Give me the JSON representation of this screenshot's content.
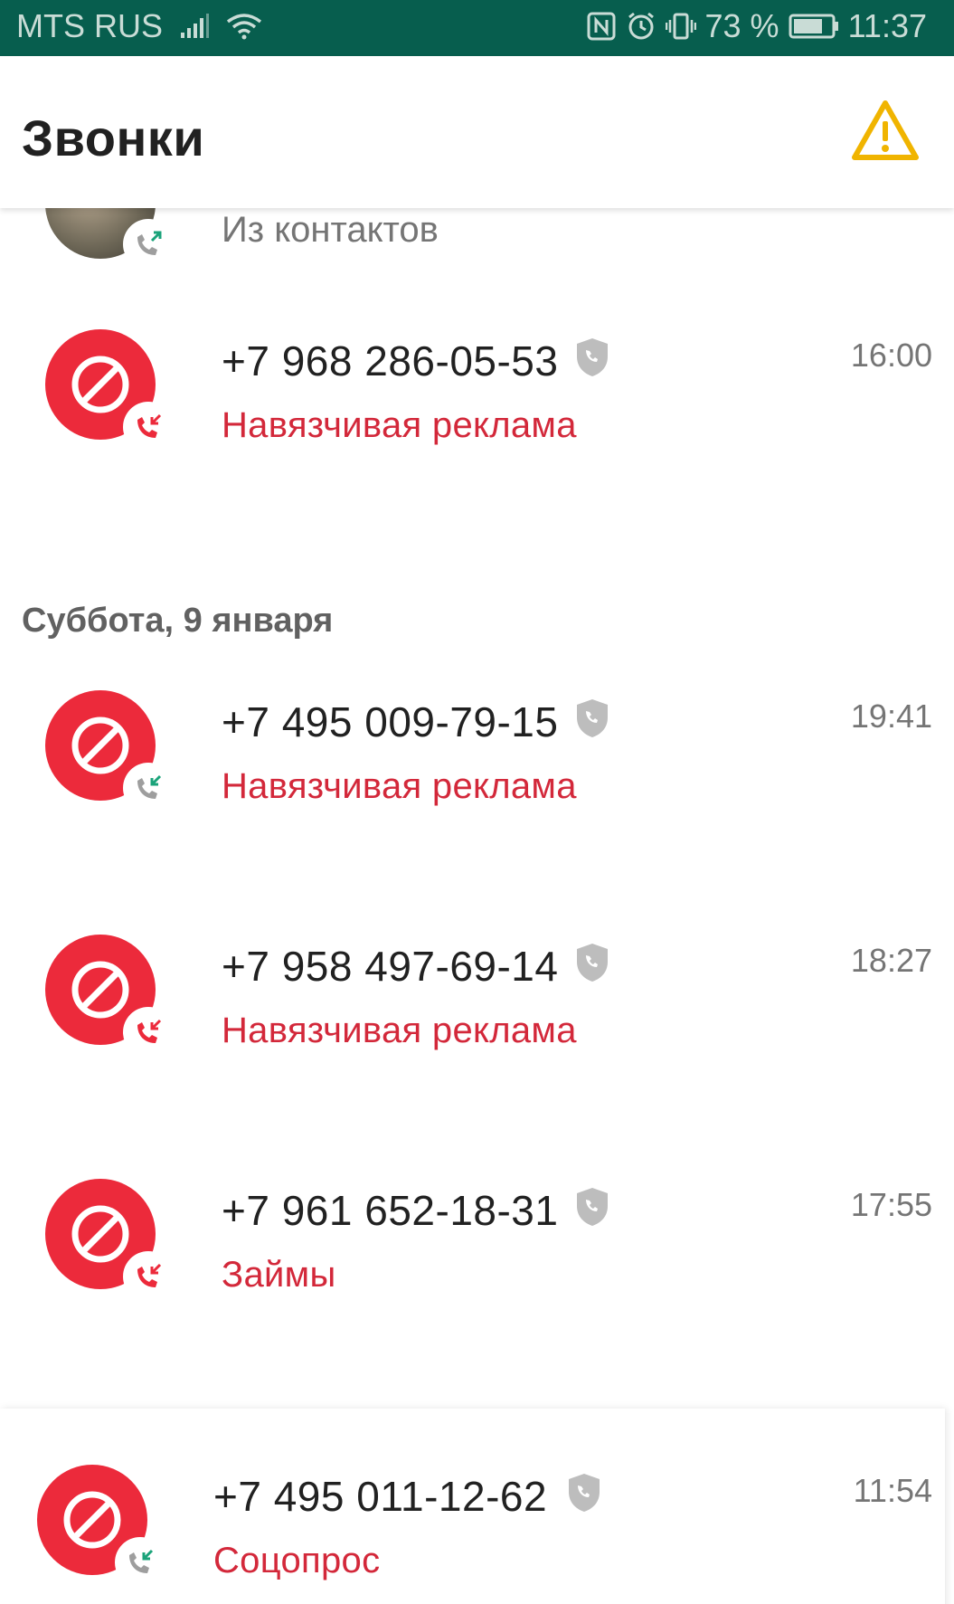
{
  "status_bar": {
    "carrier": "MTS RUS",
    "battery": "73 %",
    "time": "11:37"
  },
  "app_bar": {
    "title": "Звонки"
  },
  "partial_contact": {
    "subtitle": "Из контактов"
  },
  "calls_top": [
    {
      "number": "+7 968 286-05-53",
      "label": "Навязчивая реклама",
      "time": "16:00",
      "direction": "incoming"
    }
  ],
  "date_header": "Суббота, 9 января",
  "calls": [
    {
      "number": "+7 495 009-79-15",
      "label": "Навязчивая реклама",
      "time": "19:41",
      "direction": "incoming"
    },
    {
      "number": "+7 958 497-69-14",
      "label": "Навязчивая реклама",
      "time": "18:27",
      "direction": "incoming"
    },
    {
      "number": "+7 961 652-18-31",
      "label": "Займы",
      "time": "17:55",
      "direction": "incoming"
    },
    {
      "number": "+7 495 011-12-62",
      "label": "Соцопрос",
      "time": "11:54",
      "direction": "incoming"
    }
  ],
  "colors": {
    "status_bar": "#075e4e",
    "block_red": "#ec2a3b",
    "label_red": "#d3283a",
    "warning_yellow": "#f0b400",
    "incoming_green": "#1aa37a"
  },
  "icons": {
    "signal": "signal-icon",
    "wifi": "wifi-icon",
    "nfc": "nfc-icon",
    "alarm": "alarm-icon",
    "vibrate": "vibrate-icon",
    "battery": "battery-icon",
    "warning": "warning-icon",
    "block": "block-icon",
    "shield": "shield-icon",
    "incoming_call": "incoming-call-icon",
    "outgoing_call": "outgoing-call-icon"
  }
}
